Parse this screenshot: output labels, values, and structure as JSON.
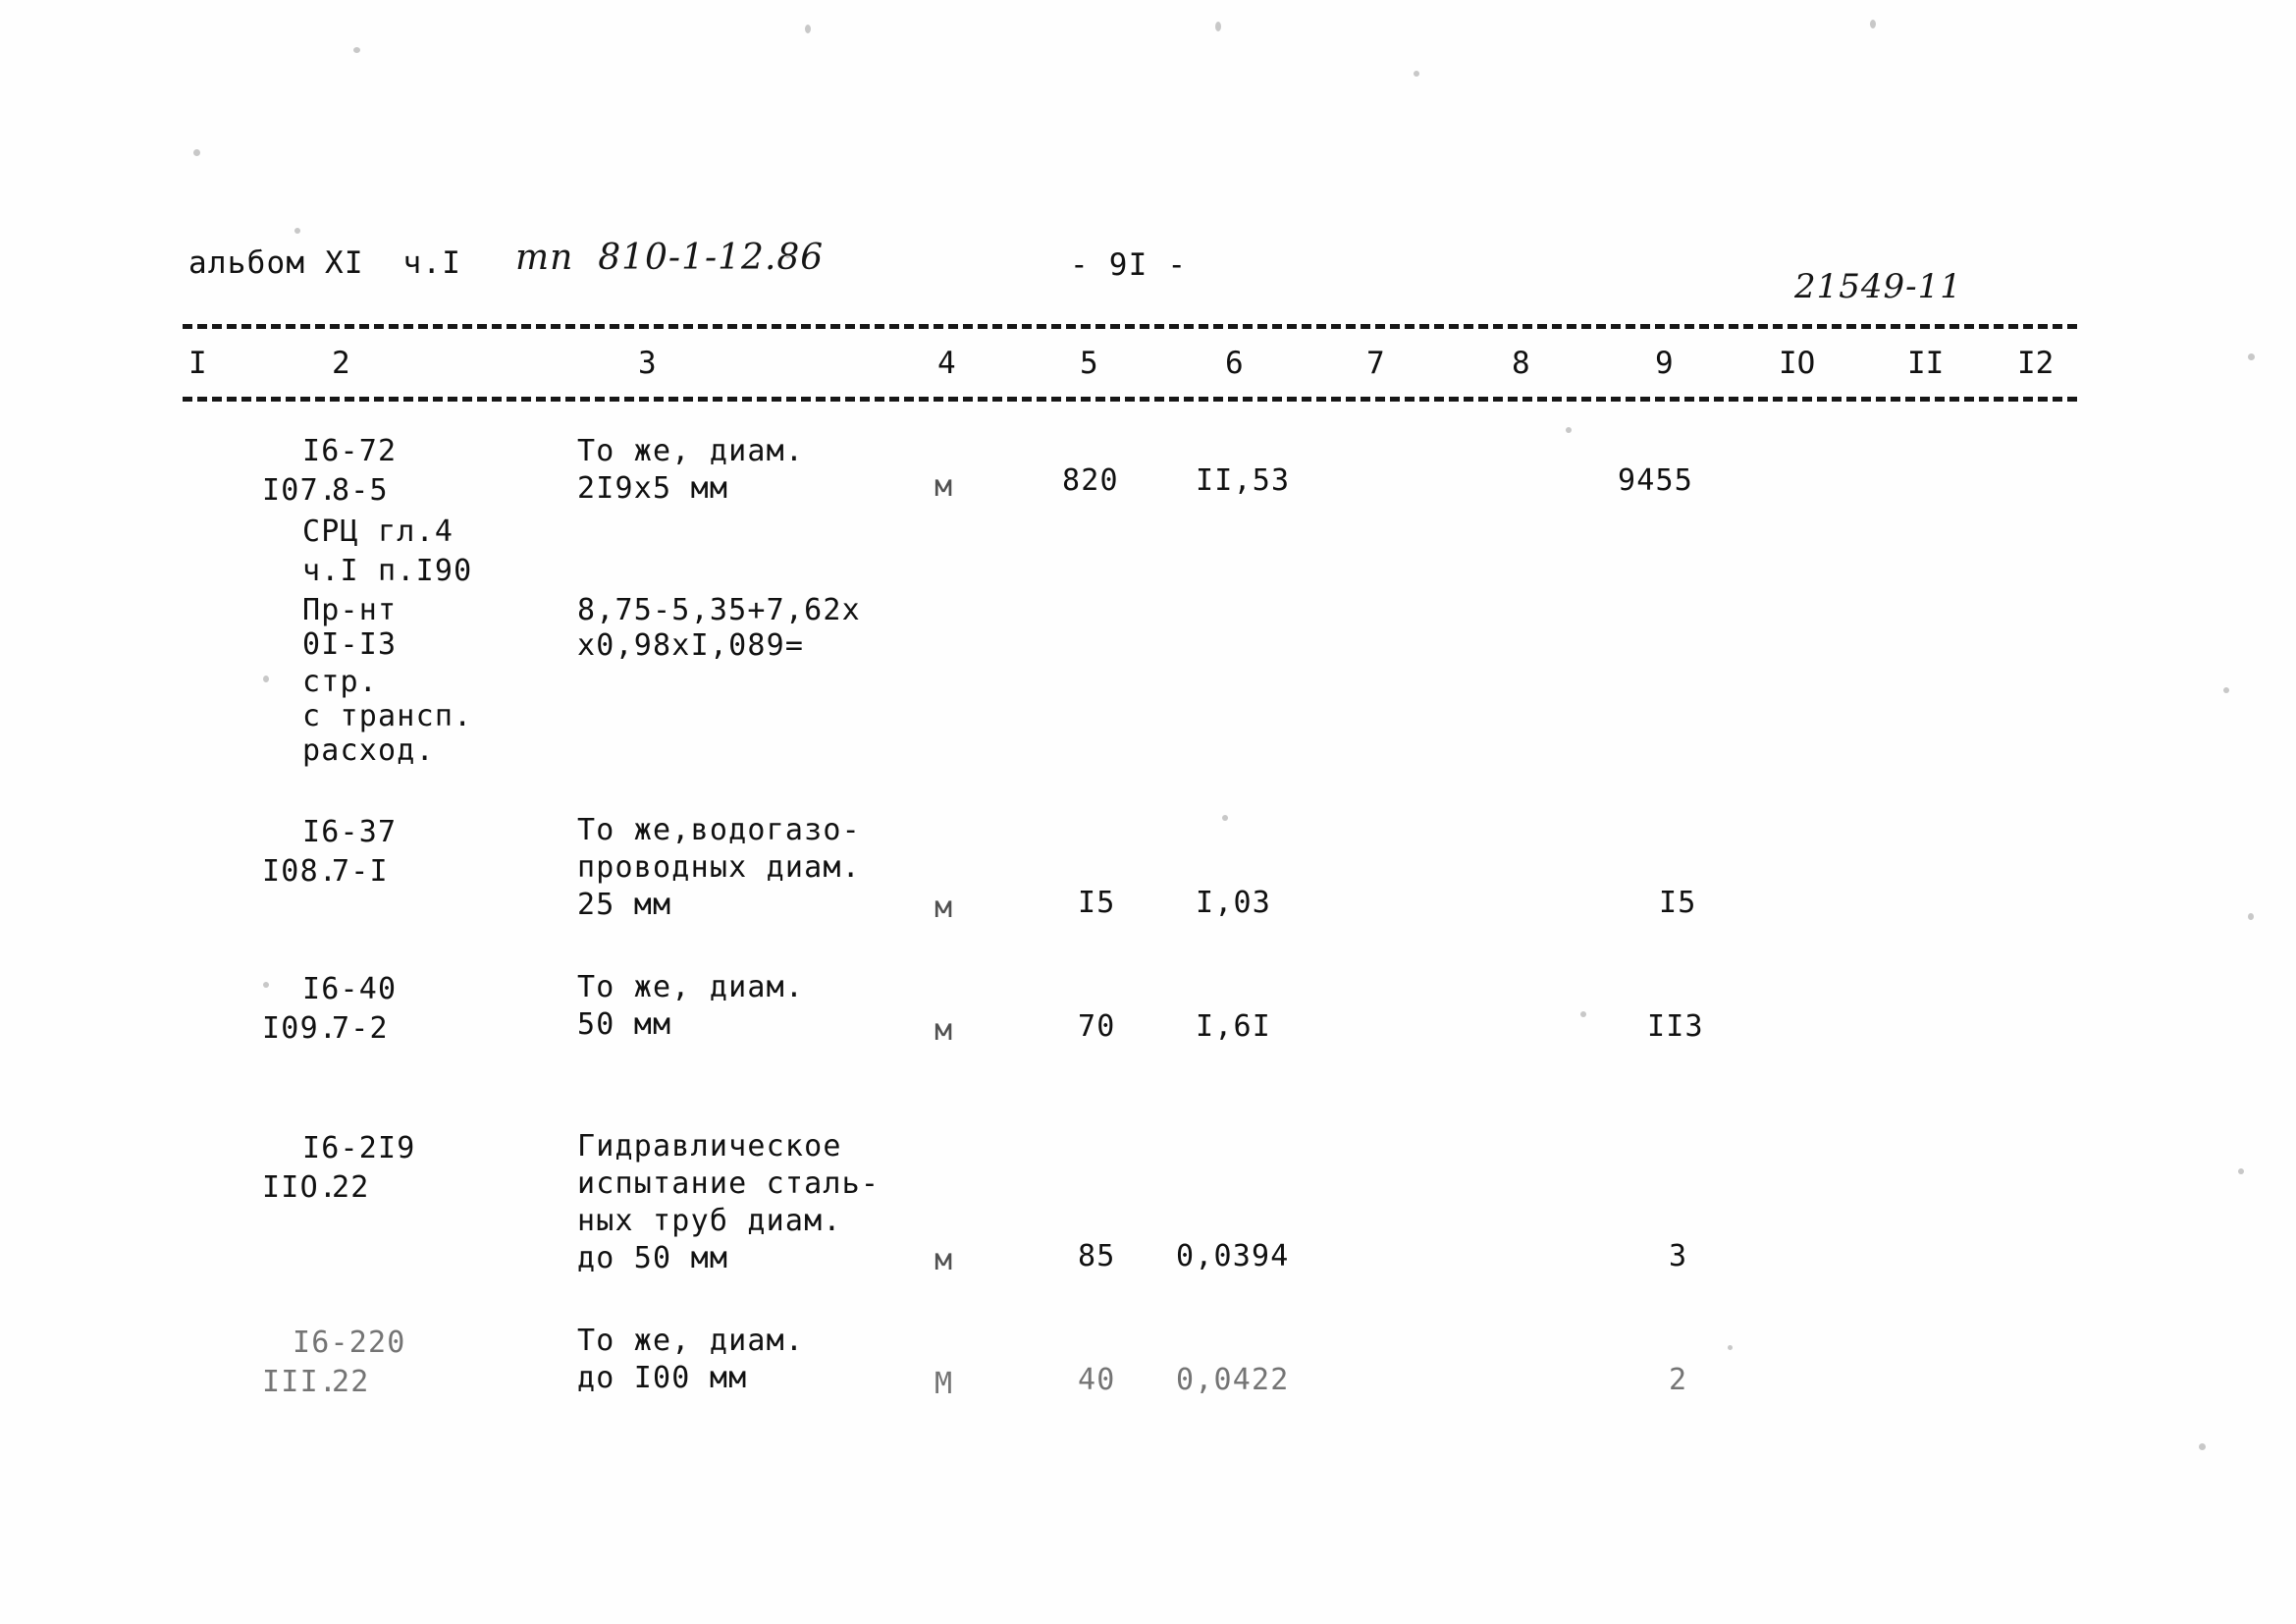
{
  "document": {
    "header": {
      "album_label": "альбом XI  ч.I",
      "handwritten_project": "тп  810-1-12.86",
      "page_number": "- 9I -",
      "handwritten_archive_code": "21549-11"
    },
    "table": {
      "column_headers": [
        "I",
        "2",
        "3",
        "4",
        "5",
        "6",
        "7",
        "8",
        "9",
        "IO",
        "II",
        "I2"
      ],
      "rows": [
        {
          "num": "I07.",
          "code_lines": [
            "I6-72",
            "8-5",
            "СРЦ гл.4",
            "ч.I п.I90",
            "Пр-нт",
            "0I-I3",
            "стр.",
            "с трансп.",
            "расход."
          ],
          "description_lines": [
            "То же, диам.",
            "2I9x5 мм"
          ],
          "formula_lines": [
            "8,75-5,35+7,62х",
            "х0,98хI,089="
          ],
          "unit": "м",
          "qty": "820",
          "price": "II,53",
          "col7": "",
          "col8": "",
          "total": "9455",
          "col10": "",
          "col11": "",
          "col12": ""
        },
        {
          "num": "I08.",
          "code_lines": [
            "I6-37",
            "7-I"
          ],
          "description_lines": [
            "То же,водогазо-",
            "проводных диам.",
            "25 мм"
          ],
          "formula_lines": [],
          "unit": "м",
          "qty": "I5",
          "price": "I,03",
          "col7": "",
          "col8": "",
          "total": "I5",
          "col10": "",
          "col11": "",
          "col12": ""
        },
        {
          "num": "I09.",
          "code_lines": [
            "I6-40",
            "7-2"
          ],
          "description_lines": [
            "То же, диам.",
            "50 мм"
          ],
          "formula_lines": [],
          "unit": "м",
          "qty": "70",
          "price": "I,6I",
          "col7": "",
          "col8": "",
          "total": "II3",
          "col10": "",
          "col11": "",
          "col12": ""
        },
        {
          "num": "IIO.",
          "code_lines": [
            "I6-2I9",
            "22"
          ],
          "description_lines": [
            "Гидравлическое",
            "испытание сталь-",
            "ных труб диам.",
            "до 50 мм"
          ],
          "formula_lines": [],
          "unit": "м",
          "qty": "85",
          "price": "0,0394",
          "col7": "",
          "col8": "",
          "total": "3",
          "col10": "",
          "col11": "",
          "col12": ""
        },
        {
          "num": "III.",
          "code_lines": [
            "I6-220",
            "22"
          ],
          "description_lines": [
            "То же, диам.",
            "до I00 мм"
          ],
          "formula_lines": [],
          "unit": "М",
          "qty": "40",
          "price": "0,0422",
          "col7": "",
          "col8": "",
          "total": "2",
          "col10": "",
          "col11": "",
          "col12": ""
        }
      ]
    }
  }
}
